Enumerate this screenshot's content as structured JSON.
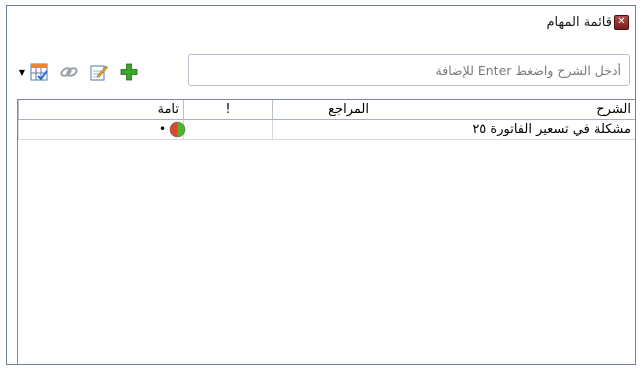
{
  "panel": {
    "title": "قائمة المهام",
    "close_icon": "close-icon"
  },
  "toolbar": {
    "input_placeholder": "أدخل الشرح واضغط Enter للإضافة",
    "input_value": "",
    "icons": [
      "add-icon",
      "edit-icon",
      "link-icon",
      "grid-options-icon",
      "dropdown-arrow-icon"
    ]
  },
  "table": {
    "columns": {
      "description": "الشرح",
      "references": "المراجع",
      "importance": "!",
      "complete": "تامة"
    },
    "rows": [
      {
        "description": "مشكلة في تسعير الفاتورة ٢٥",
        "references": "",
        "importance": "",
        "complete": "•",
        "status_icon": "status-red-green-icon"
      }
    ]
  },
  "colors": {
    "frame_border": "#6f7f95",
    "status_red": "#e0472a",
    "status_green": "#4fb22c",
    "add_green": "#3aa52a"
  }
}
